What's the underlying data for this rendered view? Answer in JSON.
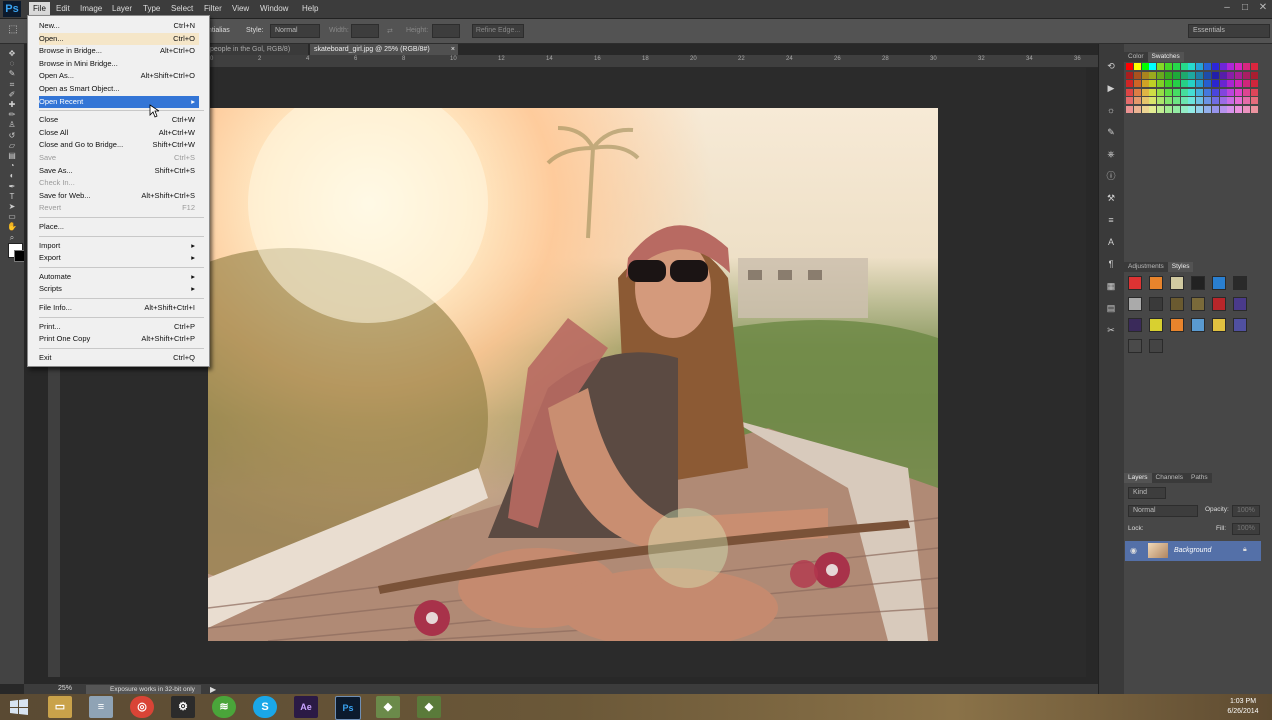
{
  "app": {
    "logo": "Ps",
    "workspace": "Essentials"
  },
  "menubar": [
    "File",
    "Edit",
    "Image",
    "Layer",
    "Type",
    "Select",
    "Filter",
    "View",
    "Window",
    "Help"
  ],
  "window_controls": [
    "–",
    "□",
    "✕"
  ],
  "options_bar": {
    "partial_label": "ntialias",
    "style_label": "Style:",
    "style_value": "Normal",
    "width_label": "Width:",
    "height_label": "Height:",
    "refine_edge": "Refine Edge..."
  },
  "tabs": [
    {
      "label": "people in the Gol, RGB/8)"
    },
    {
      "label": "skateboard_girl.jpg @ 25% (RGB/8#)",
      "close": "×"
    }
  ],
  "ruler_numbers": [
    "0",
    "2",
    "4",
    "6",
    "8",
    "10",
    "12",
    "14",
    "16",
    "18",
    "20",
    "22",
    "24",
    "26",
    "28",
    "30",
    "32",
    "34",
    "36"
  ],
  "file_menu": [
    {
      "label": "New...",
      "shortcut": "Ctrl+N"
    },
    {
      "label": "Open...",
      "shortcut": "Ctrl+O",
      "state": "hover"
    },
    {
      "label": "Browse in Bridge...",
      "shortcut": "Alt+Ctrl+O"
    },
    {
      "label": "Browse in Mini Bridge...",
      "shortcut": ""
    },
    {
      "label": "Open As...",
      "shortcut": "Alt+Shift+Ctrl+O"
    },
    {
      "label": "Open as Smart Object...",
      "shortcut": ""
    },
    {
      "label": "Open Recent",
      "shortcut": "▸",
      "state": "selected"
    },
    {
      "sep": true
    },
    {
      "label": "Close",
      "shortcut": "Ctrl+W"
    },
    {
      "label": "Close All",
      "shortcut": "Alt+Ctrl+W"
    },
    {
      "label": "Close and Go to Bridge...",
      "shortcut": "Shift+Ctrl+W"
    },
    {
      "label": "Save",
      "shortcut": "Ctrl+S",
      "disabled": true
    },
    {
      "label": "Save As...",
      "shortcut": "Shift+Ctrl+S"
    },
    {
      "label": "Check In...",
      "shortcut": "",
      "disabled": true
    },
    {
      "label": "Save for Web...",
      "shortcut": "Alt+Shift+Ctrl+S"
    },
    {
      "label": "Revert",
      "shortcut": "F12",
      "disabled": true
    },
    {
      "sep": true
    },
    {
      "label": "Place...",
      "shortcut": ""
    },
    {
      "sep": true
    },
    {
      "label": "Import",
      "shortcut": "▸"
    },
    {
      "label": "Export",
      "shortcut": "▸"
    },
    {
      "sep": true
    },
    {
      "label": "Automate",
      "shortcut": "▸"
    },
    {
      "label": "Scripts",
      "shortcut": "▸"
    },
    {
      "sep": true
    },
    {
      "label": "File Info...",
      "shortcut": "Alt+Shift+Ctrl+I"
    },
    {
      "sep": true
    },
    {
      "label": "Print...",
      "shortcut": "Ctrl+P"
    },
    {
      "label": "Print One Copy",
      "shortcut": "Alt+Shift+Ctrl+P"
    },
    {
      "sep": true
    },
    {
      "label": "Exit",
      "shortcut": "Ctrl+Q"
    }
  ],
  "statusbar": {
    "zoom": "25%",
    "message": "Exposure works in 32-bit only"
  },
  "panels": {
    "color_tabs": [
      "Color",
      "Swatches"
    ],
    "adjust_tabs": [
      "Adjustments",
      "Styles"
    ],
    "layer_tabs": [
      "Layers",
      "Channels",
      "Paths"
    ],
    "kind": "Kind",
    "blend_mode": "Normal",
    "opacity_label": "Opacity:",
    "opacity_value": "100%",
    "lock_label": "Lock:",
    "fill_label": "Fill:",
    "fill_value": "100%",
    "layer_name": "Background"
  },
  "taskbar": {
    "time": "1:03 PM",
    "date": "6/26/2014"
  },
  "colors": {
    "menu_highlight": "#3375d6",
    "menu_hover": "#f5e6c8",
    "layer_selected": "#5470a8",
    "ps_blue": "#3aa3f0"
  }
}
